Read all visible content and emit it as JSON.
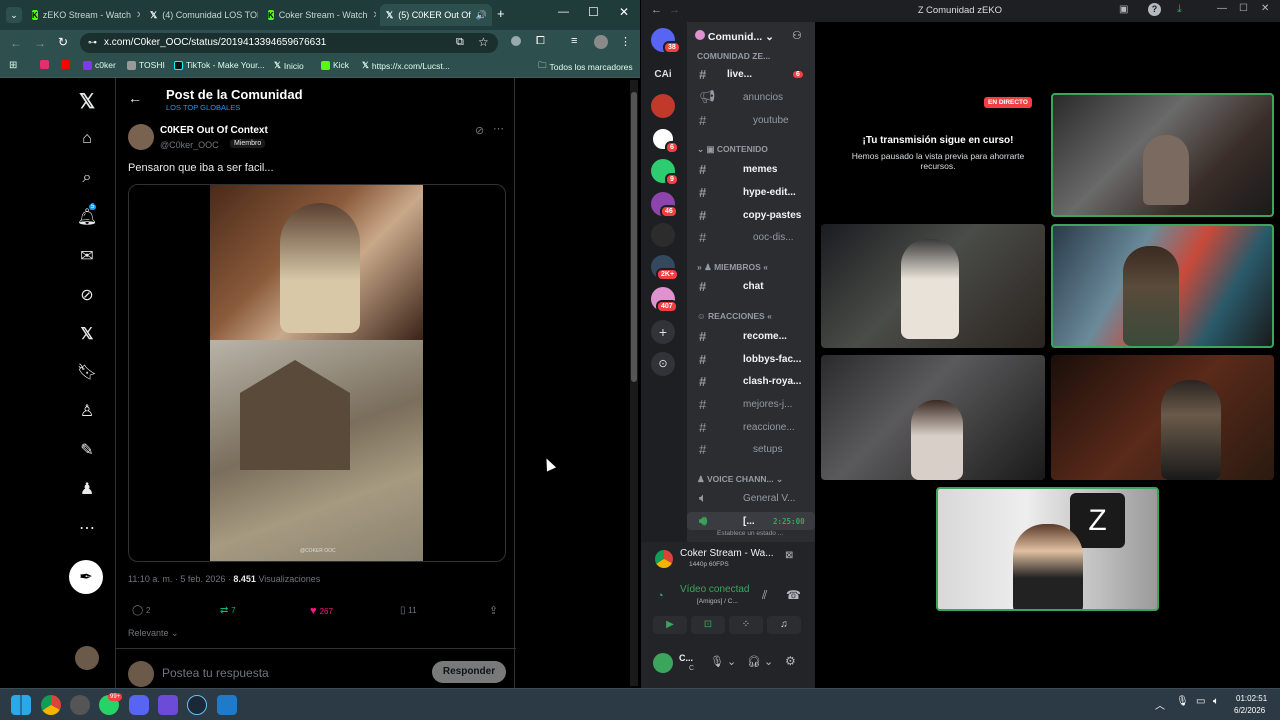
{
  "browser": {
    "tabs": [
      {
        "label": "zEKO Stream - Watch",
        "icon": "kick-icon"
      },
      {
        "label": "(4) Comunidad LOS TOP",
        "icon": "x-icon"
      },
      {
        "label": "Coker Stream - Watch",
        "icon": "kick-icon"
      },
      {
        "label": "(5) C0KER Out Of",
        "icon": "x-icon",
        "active": true
      }
    ],
    "url": "x.com/C0ker_OOC/status/2019413394659676631",
    "bookmarks": [
      "c0ker",
      "TOSHI",
      "TikTok - Make Your...",
      "Inicio",
      "Kick",
      "https://x.com/Lucst..."
    ],
    "all_bookmarks": "Todos los marcadores"
  },
  "post": {
    "header_title": "Post de la Comunidad",
    "header_sub": "LOS TOP GLOBALES",
    "author_name": "C0KER Out Of Context",
    "author_handle": "@C0ker_OOC",
    "author_role": "Miembro",
    "text": "Pensaron que iba a ser facil...",
    "time": "11:10 a. m. · 5 feb. 2026 · ",
    "views": "8.451",
    "views_label": " Visualizaciones",
    "replies": "2",
    "retweets": "7",
    "likes": "267",
    "bookmarks": "11",
    "sort": "Relevante",
    "reply_placeholder": "Postea tu respuesta",
    "reply_button": "Responder",
    "video_watermark": "@COKER OOC"
  },
  "discord": {
    "window_title": "Comunidad zEKO",
    "server_name": "Comunid...",
    "categories": {
      "top": "COMUNIDAD ZE...",
      "contenido": "CONTENIDO",
      "miembros": "MIEMBROS",
      "reacciones": "REACCIONES",
      "voice": "VOICE CHANN..."
    },
    "channels": [
      {
        "name": "live...",
        "badge": "6"
      },
      {
        "name": "anuncios"
      },
      {
        "name": "youtube"
      },
      {
        "name": "memes"
      },
      {
        "name": "hype-edit..."
      },
      {
        "name": "copy-pastes"
      },
      {
        "name": "ooc-dis..."
      },
      {
        "name": "chat"
      },
      {
        "name": "recome..."
      },
      {
        "name": "lobbys-fac..."
      },
      {
        "name": "clash-roya..."
      },
      {
        "name": "mejores-j..."
      },
      {
        "name": "reaccione..."
      },
      {
        "name": "setups"
      },
      {
        "name": "General V..."
      },
      {
        "name": "[..."
      }
    ],
    "voice_timer": "2:25:00",
    "voice_status": "Establece un estado ...",
    "server_badges": [
      "38",
      "6",
      "9",
      "46",
      "2K+",
      "407"
    ],
    "server_letters": "CAi",
    "stream_name": "Coker Stream - Wa...",
    "stream_quality": "1440p 60FPS",
    "video_status": "Vídeo conectad",
    "video_sub": "[Amigos] / C...",
    "user_name": "C...",
    "user_sub": "C",
    "live_badge": "EN DIRECTO",
    "paused_title": "¡Tu transmisión sigue en curso!",
    "paused_sub": "Hemos pausado la vista previa para ahorrarte recursos."
  },
  "taskbar": {
    "time": "01:02:51",
    "date": "6/2/2026",
    "badge": "99+"
  },
  "colors": {
    "kick_green": "#53fc18",
    "discord_red": "#f23f43",
    "speaking_green": "#3ba55c",
    "x_like": "#f91880",
    "x_rt": "#00ba7c"
  }
}
